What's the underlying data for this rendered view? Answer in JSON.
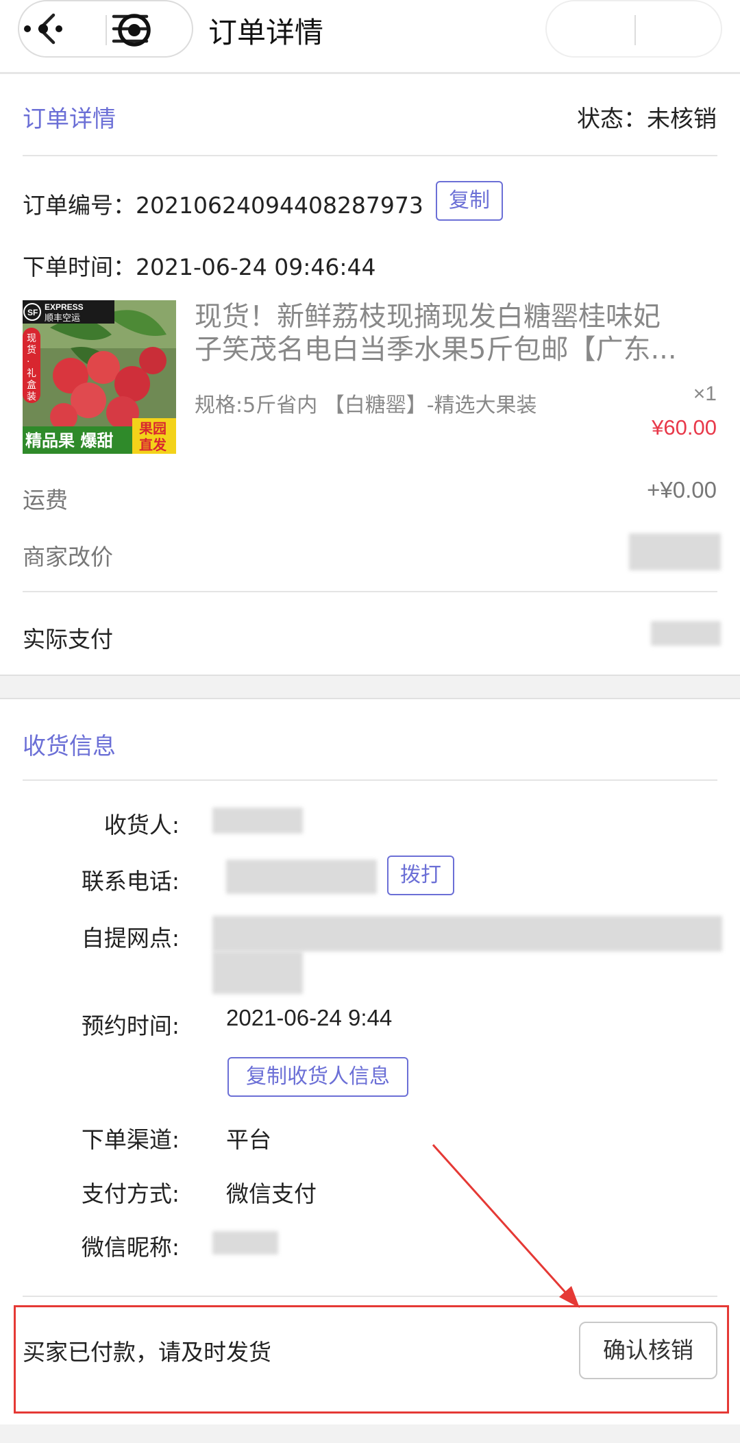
{
  "nav": {
    "title": "订单详情",
    "back_icon": "back-chevron-icon",
    "menu_icon": "hamburger-menu-icon",
    "more_icon": "more-dots-icon",
    "target_icon": "target-circle-icon"
  },
  "order": {
    "section_title": "订单详情",
    "status_label": "状态：",
    "status_value": "未核销",
    "number_label": "订单编号：",
    "number_value": "20210624094408287973",
    "copy_button": "复制",
    "time_label": "下单时间：",
    "time_value": "2021-06-24 09:46:44"
  },
  "product": {
    "title_line1": "现货！新鲜荔枝现摘现发白糖罂桂味妃",
    "title_line2": "子笑茂名电白当季水果5斤包邮【广东...",
    "spec": "规格:5斤省内 【白糖罂】-精选大果装",
    "quantity": "×1",
    "price": "¥60.00",
    "image_badges": {
      "express_brand": "EXPRESS",
      "express_cn": "顺丰空运",
      "sf": "SF",
      "gift": "现货·礼盒装",
      "slogan": "精品果 爆甜",
      "orchard": "果园直发"
    }
  },
  "fees": {
    "shipping_label": "运费",
    "shipping_value": "+¥0.00",
    "merchant_adjust_label": "商家改价",
    "actual_pay_label": "实际支付"
  },
  "shipping": {
    "section_title": "收货信息",
    "receiver_label": "收货人:",
    "phone_label": "联系电话:",
    "call_button": "拨打",
    "pickup_label": "自提网点:",
    "appointment_label": "预约时间:",
    "appointment_value": "2021-06-24 9:44",
    "copy_receiver_button": "复制收货人信息",
    "channel_label": "下单渠道:",
    "channel_value": "平台",
    "payment_label": "支付方式:",
    "payment_value": "微信支付",
    "wechat_label": "微信昵称:"
  },
  "footer": {
    "message": "买家已付款，请及时发货",
    "confirm_button": "确认核销"
  },
  "colors": {
    "accent": "#6b6fd6",
    "price_red": "#e8394a",
    "annotation_red": "#e53935"
  }
}
